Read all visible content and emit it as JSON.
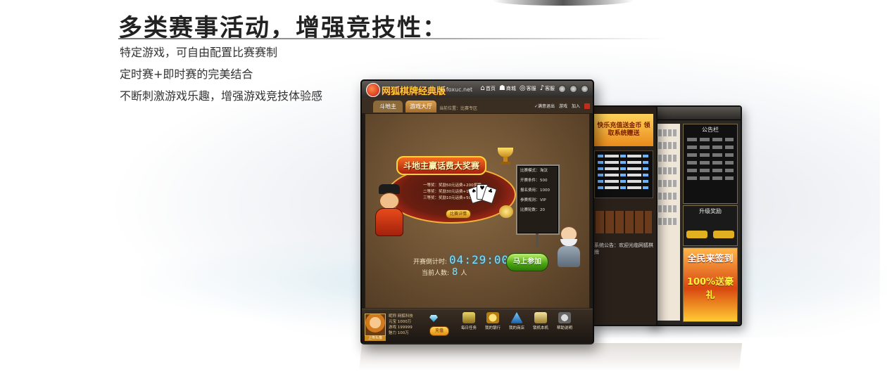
{
  "page": {
    "headline": "多类赛事活动，增强竞技性：",
    "bullets": [
      "特定游戏，可自由配置比赛赛制",
      "定时赛+即时赛的完美结合",
      "不断刺激游戏乐趣，增强游戏竞技体验感"
    ]
  },
  "app": {
    "title": "网狐棋牌经典版",
    "url": "jd.foxuc.net",
    "menu": [
      {
        "icon": "home-icon",
        "label": "首页"
      },
      {
        "icon": "shop-icon",
        "label": "商城"
      },
      {
        "icon": "service-icon",
        "label": "客服"
      },
      {
        "icon": "phone-icon",
        "label": "客服"
      }
    ],
    "tabs": {
      "active": "斗地主",
      "other": "游戏大厅"
    },
    "status_text": "当前位置：比赛专区",
    "tab_actions": [
      "✓满意退出",
      "游戏",
      "加入"
    ]
  },
  "match": {
    "banner_title": "斗地主赢话费大奖赛",
    "prizes": [
      "一等奖：奖励50元话费+200奖牌",
      "二等奖：奖励30元话费+100奖牌",
      "三等奖：奖励10元话费+50奖牌"
    ],
    "detail_button": "比赛详情",
    "rules": [
      {
        "k": "比赛模式：",
        "v": "淘汰"
      },
      {
        "k": "开赛条件：",
        "v": "500"
      },
      {
        "k": "报名费用：",
        "v": "1000"
      },
      {
        "k": "参赛规则：",
        "v": "VIP"
      },
      {
        "k": "比赛轮数：",
        "v": "20"
      }
    ],
    "countdown_label": "开赛倒计时:",
    "countdown": "04:29:00",
    "players_label": "当前人数:",
    "players_count": "8",
    "players_unit": "人",
    "join_button": "马上参加"
  },
  "bottom": {
    "avatar_caption": "上传头像",
    "stats": [
      "昵称  网狐科技",
      "元宝  1000万",
      "游戏  199999",
      "魅力  100万"
    ],
    "charge_button": "充值",
    "tools": [
      {
        "icon": "task-icon",
        "label": "每日任务"
      },
      {
        "icon": "bank-icon",
        "label": "我的银行"
      },
      {
        "icon": "shop-icon",
        "label": "我的商店"
      },
      {
        "icon": "lock-icon",
        "label": "锁机本机"
      },
      {
        "icon": "help-icon",
        "label": "帮助说明"
      }
    ]
  },
  "side": {
    "promo": "快乐充值送金币\n领取系统赠送",
    "notice_label": "系统公告：欢迎光临网狐棋牌",
    "back_notice": "公告栏",
    "back_match": "升级奖励",
    "promo_a": "全民来签到",
    "promo_b": "100%送豪礼"
  }
}
